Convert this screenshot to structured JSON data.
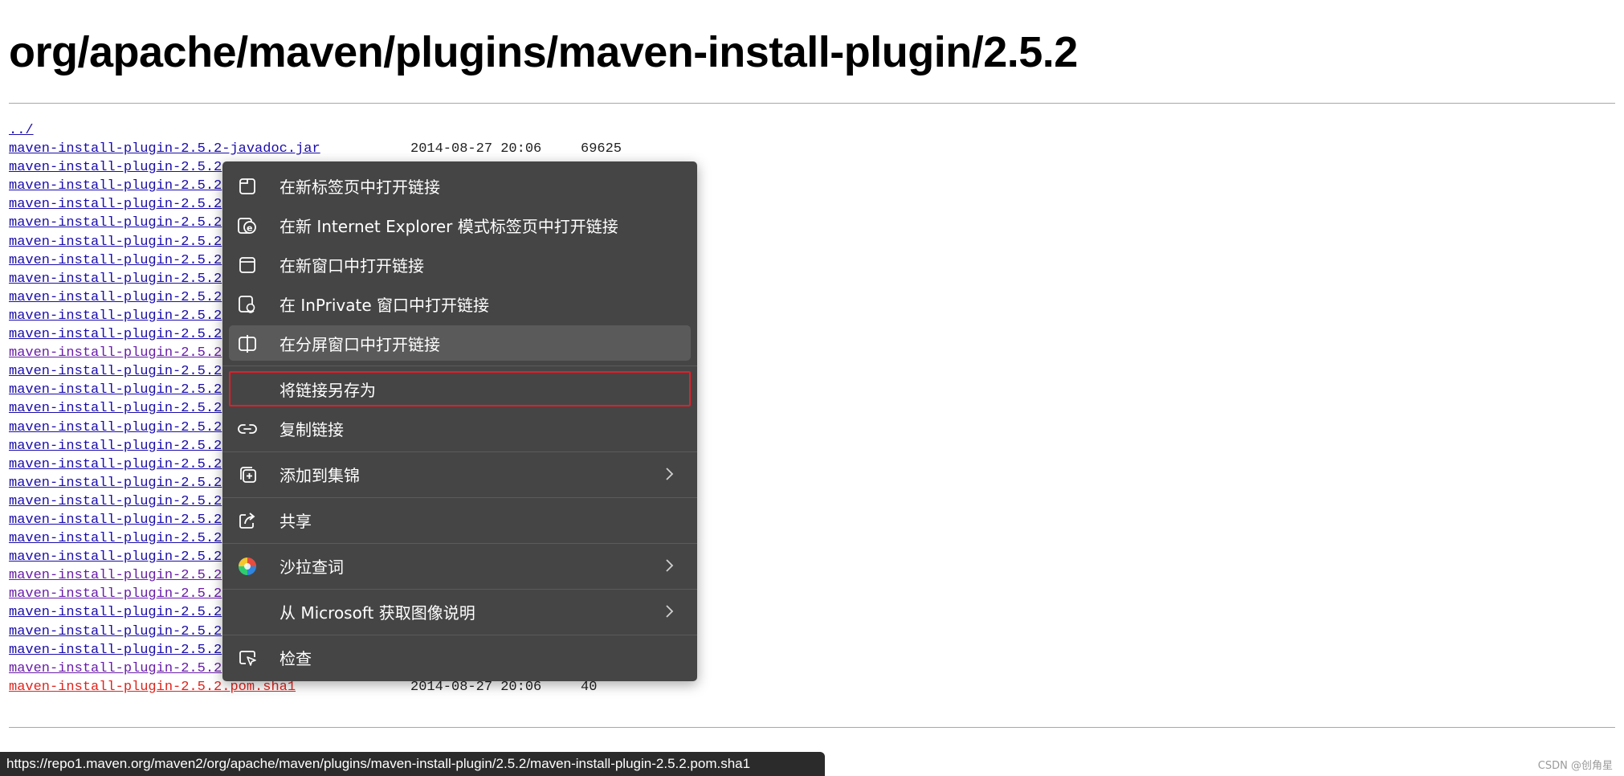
{
  "page": {
    "heading": "org/apache/maven/plugins/maven-install-plugin/2.5.2"
  },
  "listing": [
    {
      "name": "../",
      "date": "",
      "size": "",
      "state": "normal"
    },
    {
      "name": "maven-install-plugin-2.5.2-javadoc.jar",
      "date": "2014-08-27 20:06",
      "size": "69625",
      "state": "normal"
    },
    {
      "name": "maven-install-plugin-2.5.2",
      "date": "",
      "size": "",
      "state": "normal"
    },
    {
      "name": "maven-install-plugin-2.5.2",
      "date": "",
      "size": "",
      "state": "normal"
    },
    {
      "name": "maven-install-plugin-2.5.2",
      "date": "",
      "size": "",
      "state": "normal"
    },
    {
      "name": "maven-install-plugin-2.5.2",
      "date": "",
      "size": "",
      "state": "normal"
    },
    {
      "name": "maven-install-plugin-2.5.2",
      "date": "",
      "size": "",
      "state": "normal"
    },
    {
      "name": "maven-install-plugin-2.5.2",
      "date": "",
      "size": "",
      "state": "normal"
    },
    {
      "name": "maven-install-plugin-2.5.2",
      "date": "",
      "size": "",
      "state": "normal"
    },
    {
      "name": "maven-install-plugin-2.5.2",
      "date": "",
      "size": "",
      "state": "normal"
    },
    {
      "name": "maven-install-plugin-2.5.2",
      "date": "",
      "size": "",
      "state": "normal"
    },
    {
      "name": "maven-install-plugin-2.5.2",
      "date": "",
      "size": "",
      "state": "normal"
    },
    {
      "name": "maven-install-plugin-2.5.2",
      "date": "",
      "size": "",
      "state": "visited"
    },
    {
      "name": "maven-install-plugin-2.5.2",
      "date": "",
      "size": "",
      "state": "normal"
    },
    {
      "name": "maven-install-plugin-2.5.2",
      "date": "",
      "size": "",
      "state": "normal"
    },
    {
      "name": "maven-install-plugin-2.5.2",
      "date": "",
      "size": "",
      "state": "normal"
    },
    {
      "name": "maven-install-plugin-2.5.2",
      "date": "",
      "size": "",
      "state": "normal"
    },
    {
      "name": "maven-install-plugin-2.5.2",
      "date": "",
      "size": "",
      "state": "normal"
    },
    {
      "name": "maven-install-plugin-2.5.2",
      "date": "",
      "size": "",
      "state": "normal"
    },
    {
      "name": "maven-install-plugin-2.5.2",
      "date": "",
      "size": "",
      "state": "normal"
    },
    {
      "name": "maven-install-plugin-2.5.2",
      "date": "",
      "size": "",
      "state": "normal"
    },
    {
      "name": "maven-install-plugin-2.5.2",
      "date": "",
      "size": "",
      "state": "normal"
    },
    {
      "name": "maven-install-plugin-2.5.2",
      "date": "",
      "size": "",
      "state": "normal"
    },
    {
      "name": "maven-install-plugin-2.5.2",
      "date": "",
      "size": "",
      "state": "normal"
    },
    {
      "name": "maven-install-plugin-2.5.2",
      "date": "",
      "size": "",
      "state": "visited"
    },
    {
      "name": "maven-install-plugin-2.5.2",
      "date": "",
      "size": "",
      "state": "visited"
    },
    {
      "name": "maven-install-plugin-2.5.2",
      "date": "",
      "size": "",
      "state": "normal"
    },
    {
      "name": "maven-install-plugin-2.5.2",
      "date": "",
      "size": "",
      "state": "normal"
    },
    {
      "name": "maven-install-plugin-2.5.2",
      "date": "",
      "size": "",
      "state": "normal"
    },
    {
      "name": "maven-install-plugin-2.5.2",
      "date": "",
      "size": "",
      "state": "visited"
    },
    {
      "name": "maven-install-plugin-2.5.2.pom.sha1",
      "date": "2014-08-27 20:06",
      "size": "40",
      "state": "hovered"
    }
  ],
  "context_menu": {
    "items": [
      {
        "id": "open-new-tab",
        "label": "在新标签页中打开链接",
        "icon": "new-tab-icon"
      },
      {
        "id": "open-ie-mode-tab",
        "label": "在新 Internet Explorer 模式标签页中打开链接",
        "icon": "internet-explorer-icon"
      },
      {
        "id": "open-new-window",
        "label": "在新窗口中打开链接",
        "icon": "new-window-icon"
      },
      {
        "id": "open-inprivate",
        "label": "在 InPrivate 窗口中打开链接",
        "icon": "inprivate-icon"
      },
      {
        "id": "open-split-screen",
        "label": "在分屏窗口中打开链接",
        "icon": "split-screen-icon"
      },
      {
        "id": "save-link-as",
        "label": "将链接另存为",
        "icon": ""
      },
      {
        "id": "copy-link",
        "label": "复制链接",
        "icon": "link-icon"
      },
      {
        "id": "add-to-collections",
        "label": "添加到集锦",
        "icon": "collections-icon"
      },
      {
        "id": "share",
        "label": "共享",
        "icon": "share-icon"
      },
      {
        "id": "salad-lookup",
        "label": "沙拉查词",
        "icon": "salad-icon"
      },
      {
        "id": "image-description",
        "label": "从 Microsoft 获取图像说明",
        "icon": ""
      },
      {
        "id": "inspect",
        "label": "检查",
        "icon": "inspect-icon"
      }
    ]
  },
  "status_bar": {
    "url": "https://repo1.maven.org/maven2/org/apache/maven/plugins/maven-install-plugin/2.5.2/maven-install-plugin-2.5.2.pom.sha1"
  },
  "watermark": {
    "text": "CSDN @创角星"
  }
}
